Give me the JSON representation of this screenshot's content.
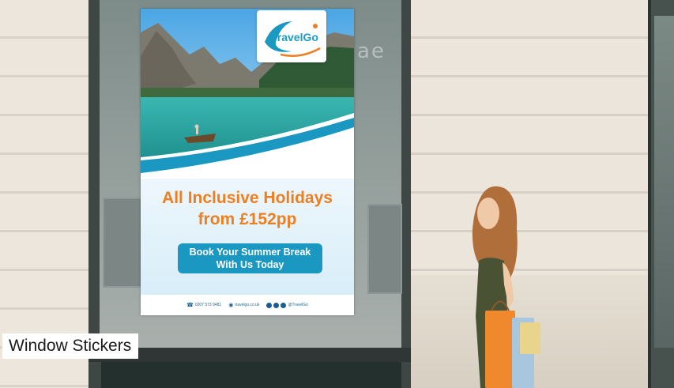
{
  "caption": "Window Stickers",
  "poster": {
    "logo_text": "TravelGo",
    "headline_line1": "All Inclusive Holidays",
    "headline_line2": "from £152pp",
    "cta_line1": "Book Your Summer Break",
    "cta_line2": "With Us Today",
    "phone": "0207 573 9481",
    "website": "travelgo.co.uk",
    "social_handle": "@TravelGo"
  },
  "glass_reflection_text": "ae",
  "colors": {
    "brand_blue": "#1a98c2",
    "headline_orange": "#ec7f22"
  }
}
